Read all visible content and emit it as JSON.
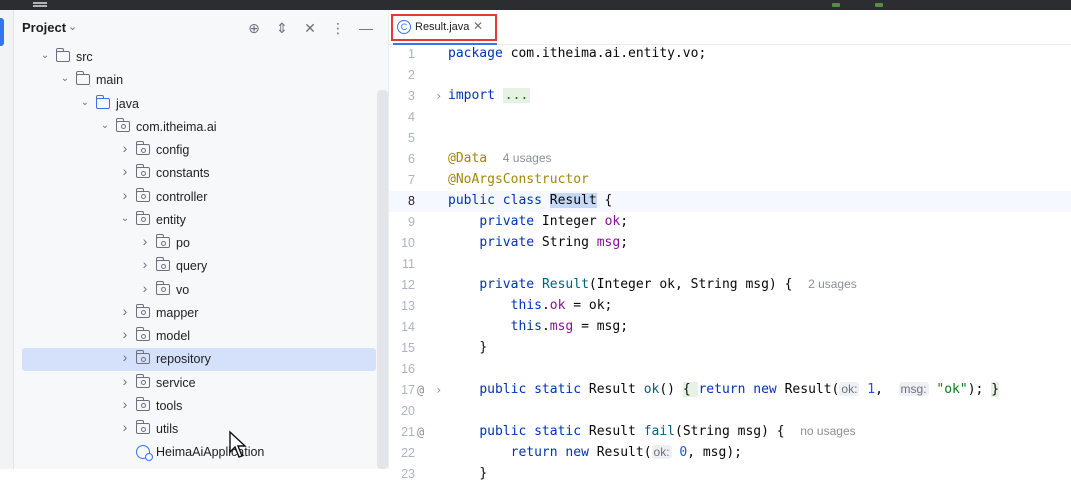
{
  "project_panel": {
    "title": "Project",
    "tree": [
      {
        "label": "src",
        "kind": "folder",
        "expanded": true
      },
      {
        "label": "main",
        "kind": "folder",
        "expanded": true
      },
      {
        "label": "java",
        "kind": "folder-source",
        "expanded": true
      },
      {
        "label": "com.itheima.ai",
        "kind": "package",
        "expanded": true
      },
      {
        "label": "config",
        "kind": "package",
        "expanded": false
      },
      {
        "label": "constants",
        "kind": "package",
        "expanded": false
      },
      {
        "label": "controller",
        "kind": "package",
        "expanded": false
      },
      {
        "label": "entity",
        "kind": "package",
        "expanded": true
      },
      {
        "label": "po",
        "kind": "package",
        "expanded": false
      },
      {
        "label": "query",
        "kind": "package",
        "expanded": false
      },
      {
        "label": "vo",
        "kind": "package",
        "expanded": false
      },
      {
        "label": "mapper",
        "kind": "package",
        "expanded": false
      },
      {
        "label": "model",
        "kind": "package",
        "expanded": false
      },
      {
        "label": "repository",
        "kind": "package",
        "expanded": false,
        "selected": true
      },
      {
        "label": "service",
        "kind": "package",
        "expanded": false
      },
      {
        "label": "tools",
        "kind": "package",
        "expanded": false
      },
      {
        "label": "utils",
        "kind": "package",
        "expanded": false
      },
      {
        "label": "HeimaAiApplication",
        "kind": "spring-app"
      }
    ]
  },
  "editor": {
    "tab": {
      "label": "Result.java",
      "icon": "class-c-icon"
    },
    "current_line": "8",
    "lines": [
      {
        "n": "1"
      },
      {
        "n": "2"
      },
      {
        "n": "3"
      },
      {
        "n": "4"
      },
      {
        "n": "5"
      },
      {
        "n": "6"
      },
      {
        "n": "7"
      },
      {
        "n": "8"
      },
      {
        "n": "9"
      },
      {
        "n": "10"
      },
      {
        "n": "11"
      },
      {
        "n": "12"
      },
      {
        "n": "13"
      },
      {
        "n": "14"
      },
      {
        "n": "15"
      },
      {
        "n": "16"
      },
      {
        "n": "17"
      },
      {
        "n": "20"
      },
      {
        "n": "21"
      },
      {
        "n": "22"
      },
      {
        "n": "23"
      }
    ],
    "tokens": {
      "l1_kw": "package",
      "l1_rest": " com.itheima.ai.entity.vo;",
      "l3_kw": "import",
      "l3_fold": "...",
      "l6_ann": "@Data",
      "l6_hint": "4 usages",
      "l7_ann": "@NoArgsConstructor",
      "l8_kw": "public class",
      "l8_name": "Result",
      "l8_rest": " {",
      "l9_kw": "private",
      "l9_type": " Integer ",
      "l9_fld": "ok",
      "l9_end": ";",
      "l10_kw": "private",
      "l10_type": " String ",
      "l10_fld": "msg",
      "l10_end": ";",
      "l12_kw": "private",
      "l12_fn": "Result",
      "l12_rest": "(Integer ok, String msg) {",
      "l12_hint": "2 usages",
      "l13_kw": "this",
      "l13_fld": "ok",
      "l13_rest": " = ok;",
      "l14_kw": "this",
      "l14_fld": "msg",
      "l14_rest": " = msg;",
      "l15": "}",
      "l17_kw": "public static",
      "l17_type": " Result ",
      "l17_fn": "ok",
      "l17_a": "() ",
      "l17_b": "{ ",
      "l17_kw2": "return new",
      "l17_c": " Result(",
      "l17_inlay1": "ok:",
      "l17_num": "1",
      "l17_d": ", ",
      "l17_inlay2": "msg:",
      "l17_str": "\"ok\"",
      "l17_e": "); ",
      "l17_f": "}",
      "l21_kw": "public static",
      "l21_type": " Result ",
      "l21_fn": "fail",
      "l21_rest": "(String msg) {",
      "l21_hint": "no usages",
      "l22_kw": "return new",
      "l22_a": " Result(",
      "l22_inlay": "ok:",
      "l22_num": "0",
      "l22_b": ", msg);",
      "l23": "}"
    }
  }
}
